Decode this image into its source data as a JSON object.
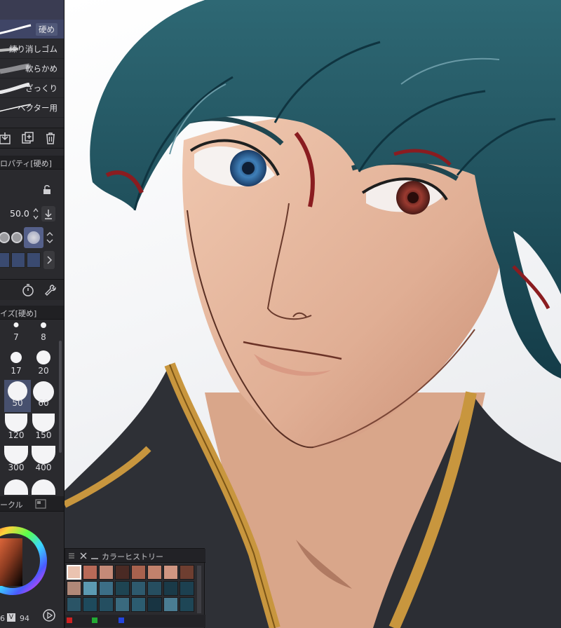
{
  "brushes": [
    {
      "label": "硬め",
      "selected": true
    },
    {
      "label": "練り消しゴム",
      "selected": false
    },
    {
      "label": "軟らかめ",
      "selected": false
    },
    {
      "label": "ざっくり",
      "selected": false
    },
    {
      "label": "ベクター用",
      "selected": false
    }
  ],
  "tool_property": {
    "title": "ロパティ[硬め]",
    "size_value": "50.0"
  },
  "brush_size": {
    "title": "イズ[硬め]",
    "sizes": [
      "7",
      "8",
      "17",
      "20",
      "50",
      "60",
      "120",
      "150",
      "300",
      "400"
    ],
    "selected": "50"
  },
  "color_wheel": {
    "title": "ークル",
    "values": [
      "6",
      "V",
      "94"
    ]
  },
  "color_history": {
    "title": "カラーヒストリー",
    "colors": [
      "#eac3b0",
      "#b86a58",
      "#c48a78",
      "#4a2a24",
      "#a8624e",
      "#c2826c",
      "#d09682",
      "#6e3e30",
      "#b08878",
      "#5c9ab2",
      "#3c6e86",
      "#1e4452",
      "#2e5a6e",
      "#264e60",
      "#1a3a48",
      "#1c4050",
      "#2a5466",
      "#1e4a5c",
      "#244e60",
      "#3a6a7e",
      "#2c5c70",
      "#183442",
      "#4a7c92",
      "#1e4656"
    ],
    "footer_colors": [
      "#cc2222",
      "#22aa33",
      "#2244dd"
    ]
  },
  "colors": {
    "panel_bg": "#2a2a2e",
    "selection": "#47506e",
    "hair": "#1d4c58",
    "skin": "#e6b89c",
    "jacket": "#2e3036",
    "trim": "#c8963e"
  }
}
